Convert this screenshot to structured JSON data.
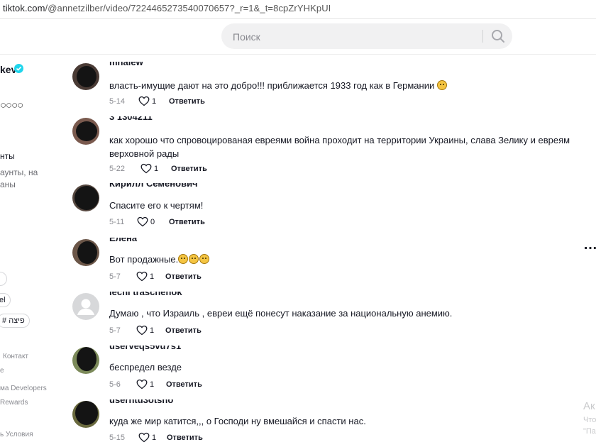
{
  "browser": {
    "url_host": "tiktok.com",
    "url_path": "/@annetzilber/video/7224465273540070657?_r=1&_t=8cpZrYHKpUI"
  },
  "search": {
    "placeholder": "Поиск"
  },
  "sidebar": {
    "name_fragment": "kev",
    "circles": "○○○○",
    "accounts_label": "нты",
    "accounts_hint_line1": "аунты, на",
    "accounts_hint_line2": "аны",
    "pill_1": "",
    "pill_2": "el",
    "pill_3": "# פיצה",
    "footer": [
      "Контакт",
      "е",
      "ма Developers",
      "Rewards",
      "ь Условия"
    ]
  },
  "comments": [
    {
      "username": "mnalew",
      "text": "власть-имущие дают на это добро!!! приближается 1933 год как в Германии",
      "emoji_count": 1,
      "date": "5-14",
      "likes": "1",
      "reply": "Ответить"
    },
    {
      "username": "3 1304211",
      "text": "как хорошо что спровоцированая евреями война проходит на территории Украины, слава Зелику и евреям верховной рады",
      "emoji_count": 0,
      "date": "5-22",
      "likes": "1",
      "reply": "Ответить"
    },
    {
      "username": "Кирилл Семенович",
      "text": "Спасите его к чертям!",
      "emoji_count": 0,
      "date": "5-11",
      "likes": "0",
      "reply": "Ответить"
    },
    {
      "username": "Елена",
      "text": "Вот продажные.",
      "emoji_count": 3,
      "date": "5-7",
      "likes": "1",
      "reply": "Ответить"
    },
    {
      "username": "lecni traschenok",
      "text": "Думаю , что Израиль , евреи ещё понесут наказание за национальную анемию.",
      "emoji_count": 0,
      "date": "5-7",
      "likes": "1",
      "reply": "Ответить"
    },
    {
      "username": "userveqs5vu7s1",
      "text": "беспредел везде",
      "emoji_count": 0,
      "date": "5-6",
      "likes": "1",
      "reply": "Ответить"
    },
    {
      "username": "userntu3otsho",
      "text": "куда же мир катится,,, о Господи ну вмешайся и спасти нас.",
      "emoji_count": 0,
      "date": "5-15",
      "likes": "1",
      "reply": "Ответить"
    }
  ],
  "more_menu": "…",
  "watermark": {
    "line1": "Ак",
    "line2": "Что",
    "line3": "\"Па"
  }
}
